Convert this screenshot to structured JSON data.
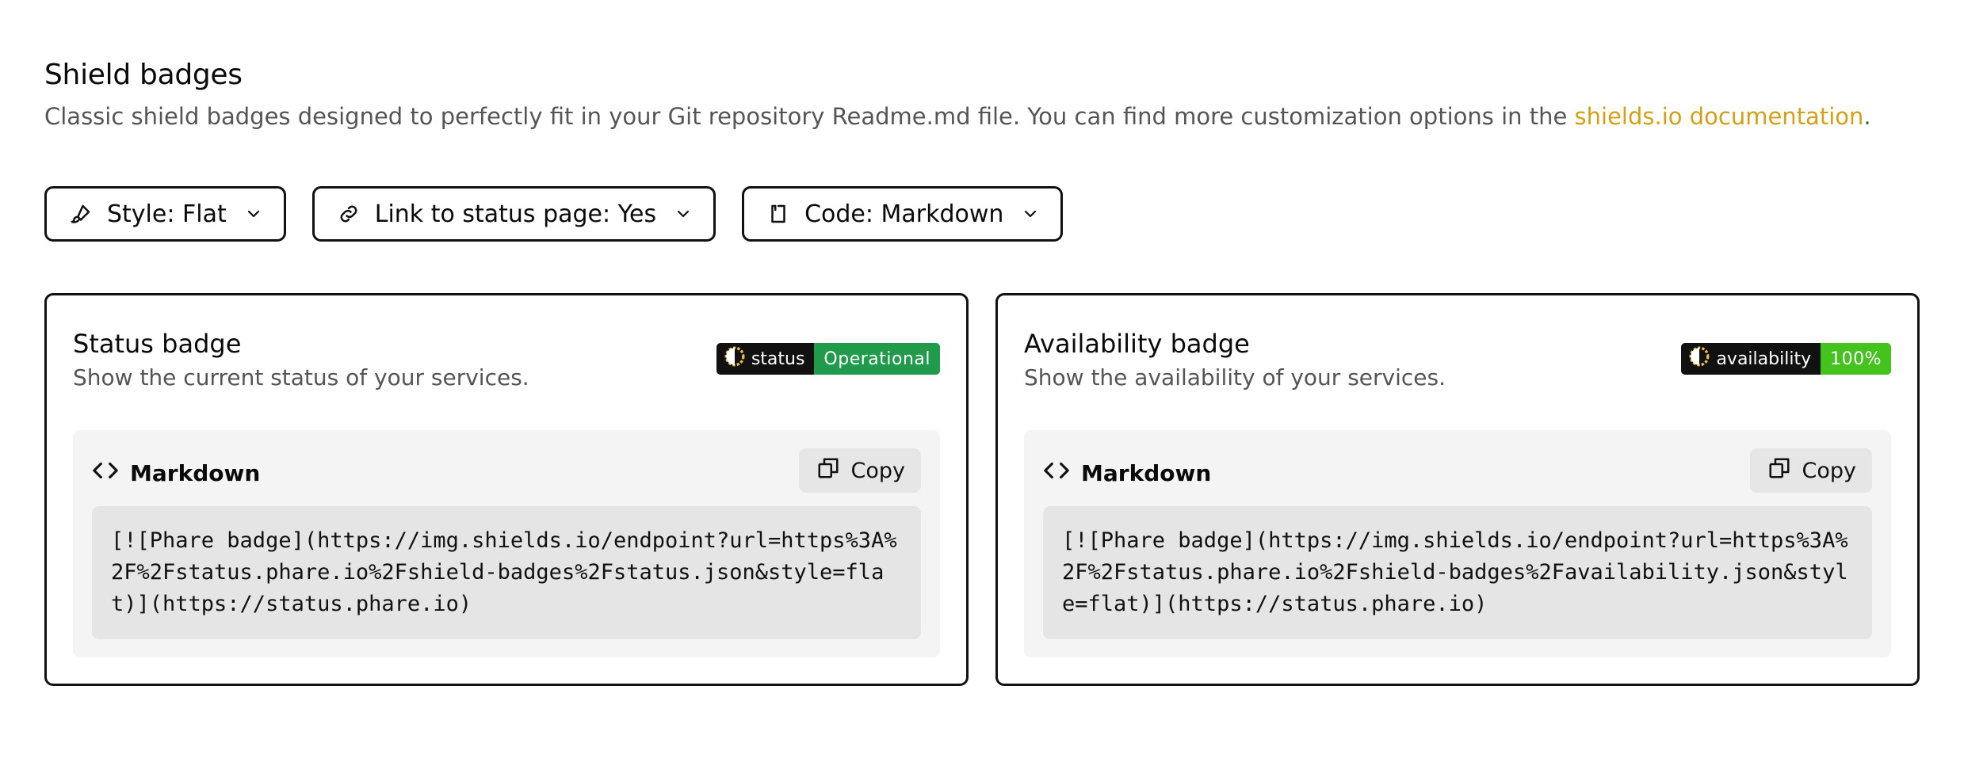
{
  "header": {
    "title": "Shield badges",
    "subtitle": "Classic shield badges designed to perfectly fit in your Git repository Readme.md file. You can find more customization options in the ",
    "link_text": "shields.io documentation",
    "subtitle_end": "."
  },
  "filters": [
    {
      "label": "Style: Flat",
      "icon": "brush-icon"
    },
    {
      "label": "Link to status page: Yes",
      "icon": "link-icon"
    },
    {
      "label": "Code: Markdown",
      "icon": "code-file-icon"
    }
  ],
  "cards": [
    {
      "title": "Status badge",
      "description": "Show the current status of your services.",
      "badge": {
        "left": "status",
        "right": "Operational",
        "right_color": "#1f9b4b"
      },
      "code_label": "Markdown",
      "copy_label": "Copy",
      "code": "[![Phare badge](https://img.shields.io/endpoint?url=https%3A%2F%2Fstatus.phare.io%2Fshield-badges%2Fstatus.json&style=flat)](https://status.phare.io)"
    },
    {
      "title": "Availability badge",
      "description": "Show the availability of your services.",
      "badge": {
        "left": "availability",
        "right": "100%",
        "right_color": "#44c21d"
      },
      "code_label": "Markdown",
      "copy_label": "Copy",
      "code": "[![Phare badge](https://img.shields.io/endpoint?url=https%3A%2F%2Fstatus.phare.io%2Fshield-badges%2Favailability.json&style=flat)](https://status.phare.io)"
    }
  ],
  "colors": {
    "accent": "#d4a017",
    "border": "#111111"
  }
}
